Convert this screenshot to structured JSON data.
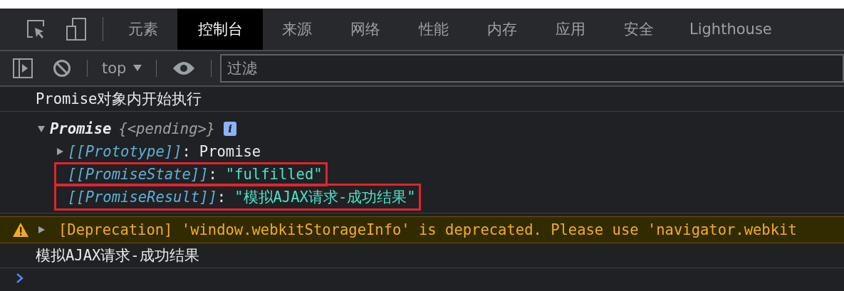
{
  "tabs": [
    {
      "label": "元素",
      "selected": false
    },
    {
      "label": "控制台",
      "selected": true
    },
    {
      "label": "来源",
      "selected": false
    },
    {
      "label": "网络",
      "selected": false
    },
    {
      "label": "性能",
      "selected": false
    },
    {
      "label": "内存",
      "selected": false
    },
    {
      "label": "应用",
      "selected": false
    },
    {
      "label": "安全",
      "selected": false
    },
    {
      "label": "Lighthouse",
      "selected": false
    }
  ],
  "toolbar": {
    "context": "top",
    "filter": {
      "placeholder": "过滤"
    }
  },
  "console": [
    {
      "kind": "log",
      "text": "Promise对象内开始执行"
    },
    {
      "kind": "object",
      "expanded": true,
      "name": "Promise",
      "preview": "{<pending>}",
      "info": "i",
      "separator": ":",
      "properties": [
        {
          "key": "[[Prototype]]",
          "value": "Promise",
          "kind": "object",
          "expandable": true,
          "highlighted": false
        },
        {
          "key": "[[PromiseState]]",
          "value": "\"fulfilled\"",
          "kind": "string",
          "expandable": false,
          "highlighted": true
        },
        {
          "key": "[[PromiseResult]]",
          "value": "\"模拟AJAX请求-成功结果\"",
          "kind": "string",
          "expandable": false,
          "highlighted": true
        }
      ]
    },
    {
      "kind": "warning",
      "expanded": false,
      "text": "[Deprecation] 'window.webkitStorageInfo' is deprecated. Please use 'navigator.webkit"
    },
    {
      "kind": "log",
      "text": "模拟AJAX请求-成功结果"
    },
    {
      "kind": "prompt"
    }
  ]
}
